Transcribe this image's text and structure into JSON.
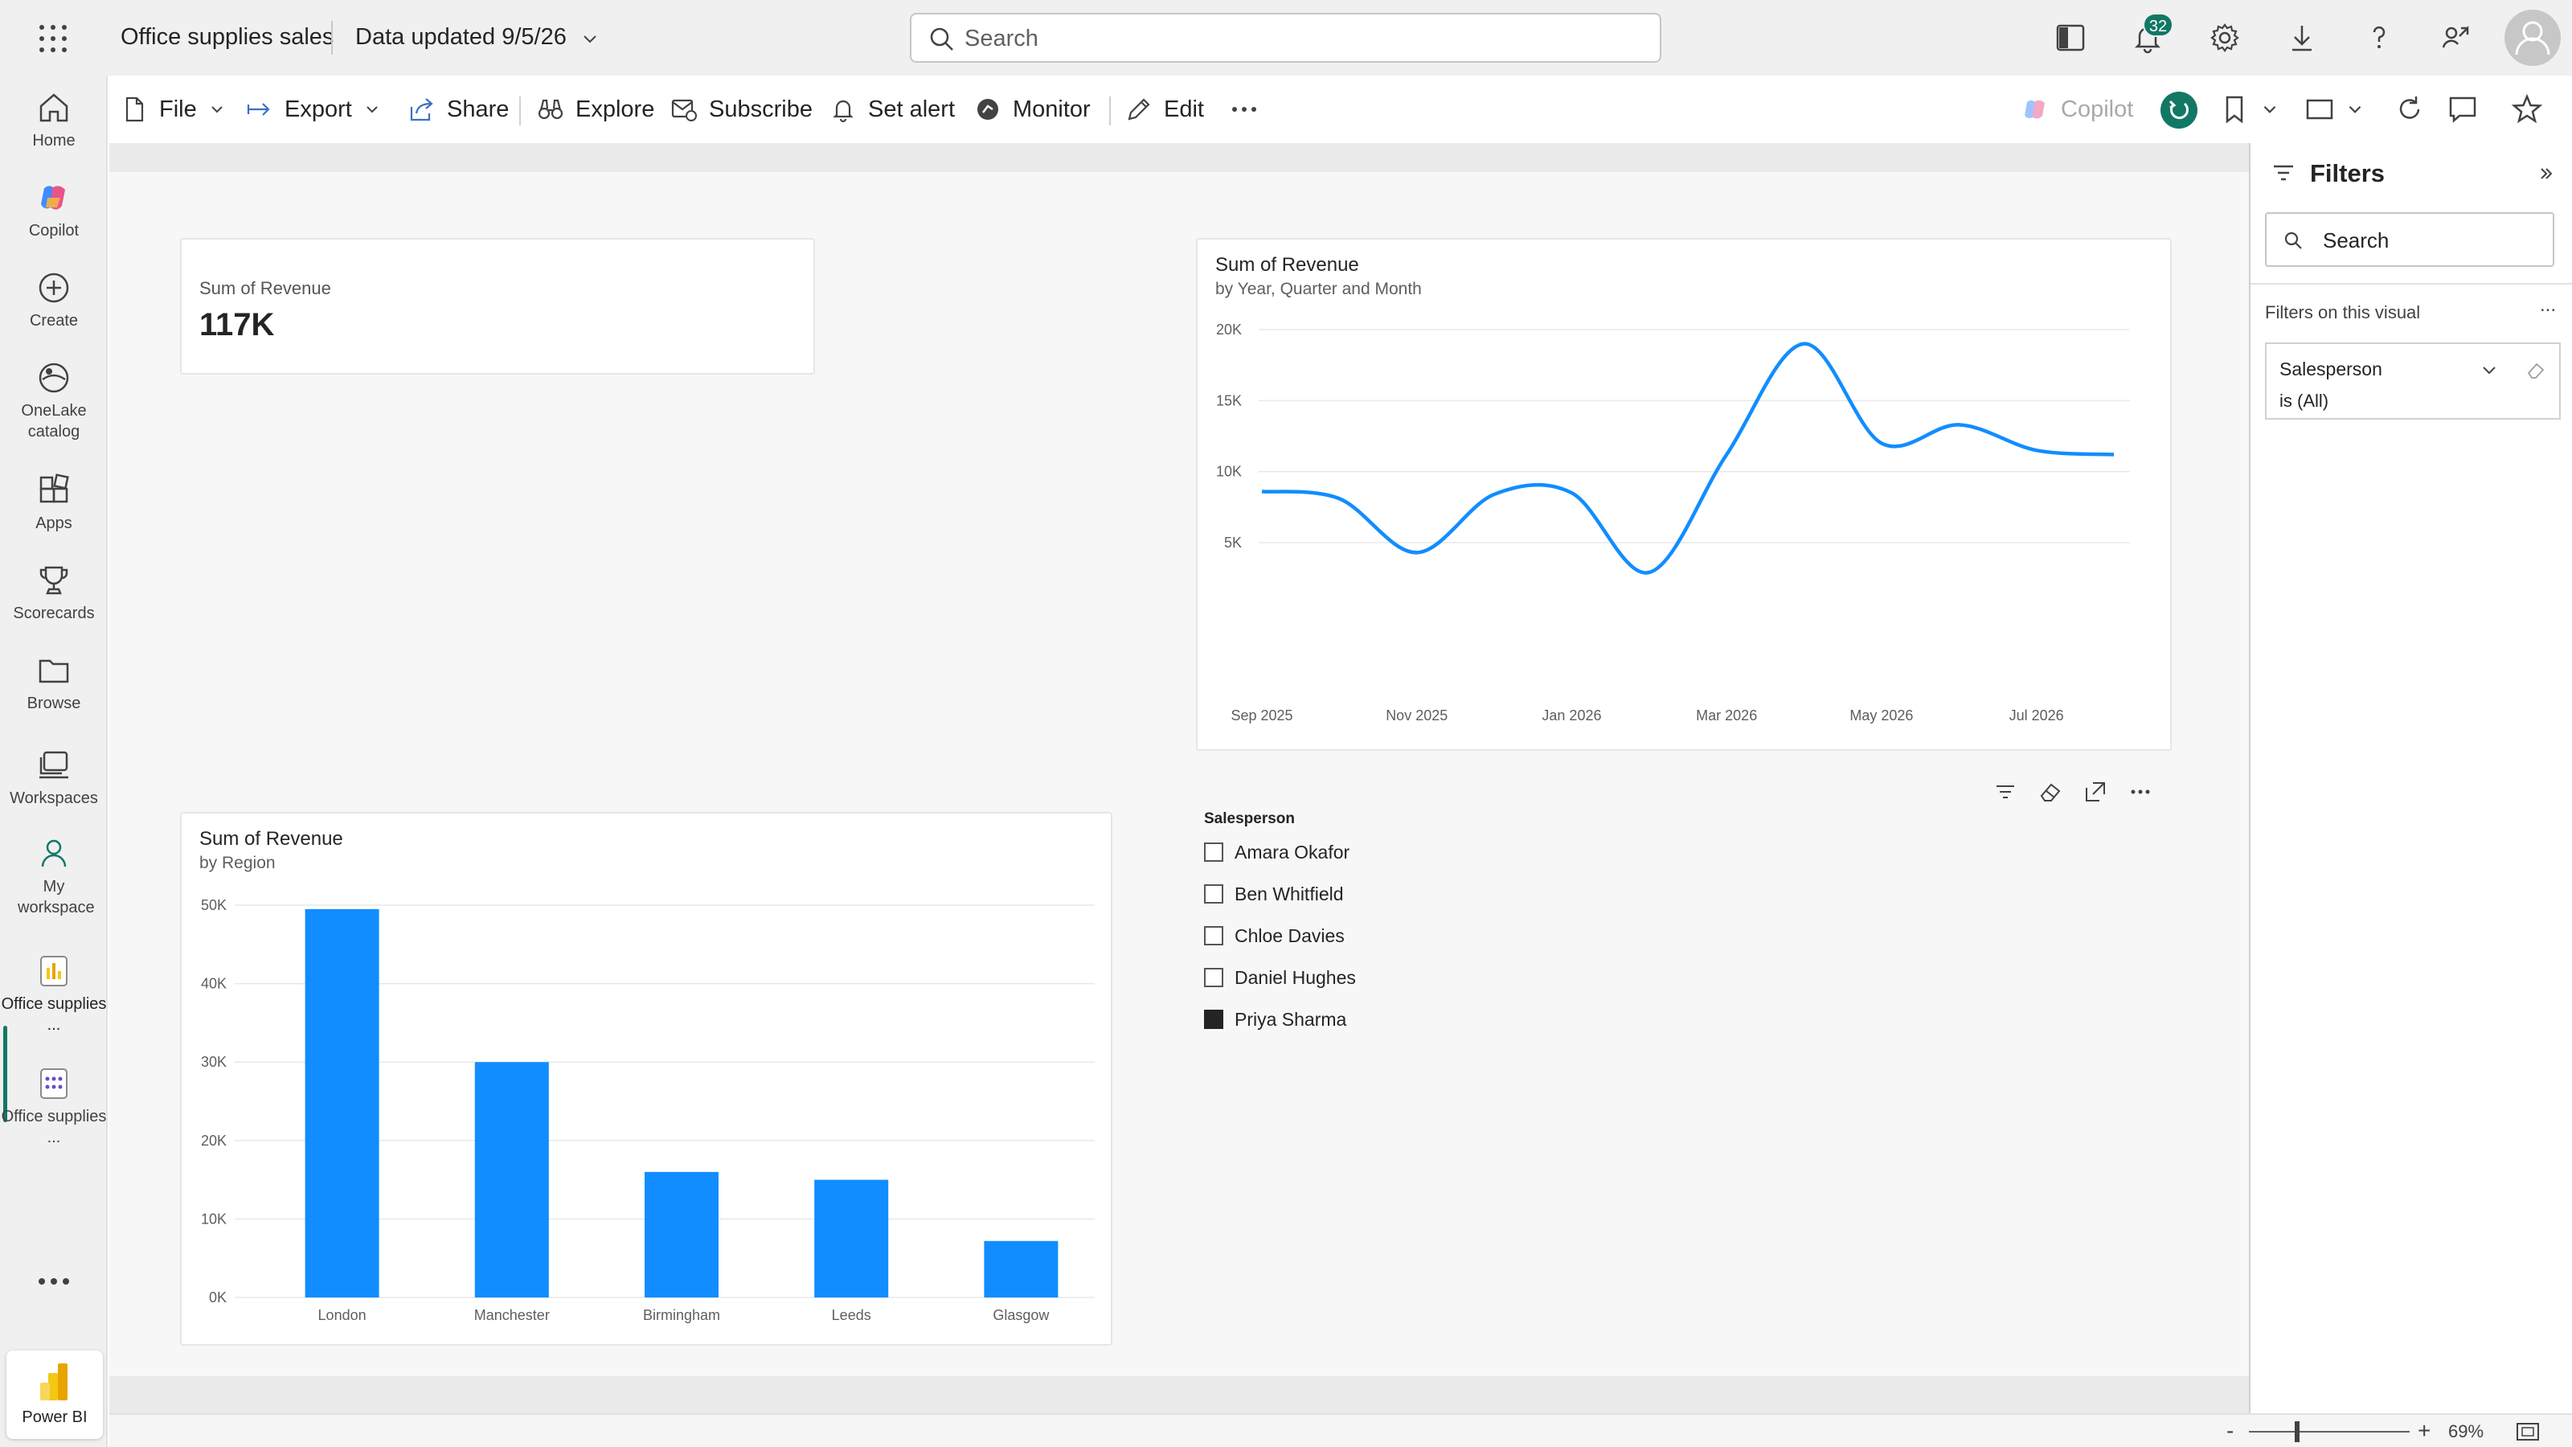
{
  "topbar": {
    "app_title": "Office supplies sales",
    "data_updated": "Data updated 9/5/26",
    "search_placeholder": "Search",
    "notification_count": "32"
  },
  "leftnav": {
    "items": [
      {
        "label": "Home",
        "icon": "home-icon"
      },
      {
        "label": "Copilot",
        "icon": "copilot-icon"
      },
      {
        "label": "Create",
        "icon": "create-icon"
      },
      {
        "label": "OneLake catalog",
        "icon": "onelake-icon"
      },
      {
        "label": "Apps",
        "icon": "apps-icon"
      },
      {
        "label": "Scorecards",
        "icon": "trophy-icon"
      },
      {
        "label": "Browse",
        "icon": "folder-icon"
      },
      {
        "label": "Workspaces",
        "icon": "workspaces-icon"
      },
      {
        "label": "My workspace",
        "icon": "person-icon"
      },
      {
        "label": "Office supplies ...",
        "icon": "report-icon"
      },
      {
        "label": "Office supplies ...",
        "icon": "semantic-model-icon"
      }
    ],
    "powerbi_label": "Power BI"
  },
  "commandbar": {
    "file": "File",
    "export": "Export",
    "share": "Share",
    "explore": "Explore",
    "subscribe": "Subscribe",
    "set_alert": "Set alert",
    "monitor": "Monitor",
    "edit": "Edit",
    "copilot": "Copilot"
  },
  "kpi": {
    "label": "Sum of Revenue",
    "value": "117K"
  },
  "line_chart": {
    "title": "Sum of Revenue",
    "subtitle": "by Year, Quarter and Month"
  },
  "bar_chart": {
    "title": "Sum of Revenue",
    "subtitle": "by Region"
  },
  "chart_data": [
    {
      "type": "line",
      "title": "Sum of Revenue",
      "subtitle": "by Year, Quarter and Month",
      "x": [
        "Sep 2025",
        "Oct 2025",
        "Nov 2025",
        "Dec 2025",
        "Jan 2026",
        "Feb 2026",
        "Mar 2026",
        "Apr 2026",
        "May 2026",
        "Jun 2026",
        "Jul 2026",
        "Aug 2026"
      ],
      "x_tick_labels": [
        "Sep 2025",
        "Nov 2025",
        "Jan 2026",
        "Mar 2026",
        "May 2026",
        "Jul 2026"
      ],
      "values": [
        8600,
        8100,
        4300,
        8400,
        8500,
        2900,
        11200,
        19000,
        12000,
        13300,
        11500,
        11200
      ],
      "ylim": [
        2000,
        20000
      ],
      "y_ticks": [
        "5K",
        "10K",
        "15K",
        "20K"
      ],
      "y_tick_values": [
        5000,
        10000,
        15000,
        20000
      ],
      "color": "#118DFF",
      "grid": true
    },
    {
      "type": "bar",
      "title": "Sum of Revenue",
      "subtitle": "by Region",
      "categories": [
        "London",
        "Manchester",
        "Birmingham",
        "Leeds",
        "Glasgow"
      ],
      "values": [
        49500,
        30000,
        16000,
        15000,
        7200
      ],
      "ylim": [
        0,
        50000
      ],
      "y_ticks": [
        "0K",
        "10K",
        "20K",
        "30K",
        "40K",
        "50K"
      ],
      "y_tick_values": [
        0,
        10000,
        20000,
        30000,
        40000,
        50000
      ],
      "color": "#118DFF",
      "grid": true
    }
  ],
  "slicer": {
    "title": "Salesperson",
    "items": [
      {
        "label": "Amara Okafor",
        "checked": false
      },
      {
        "label": "Ben Whitfield",
        "checked": false
      },
      {
        "label": "Chloe Davies",
        "checked": false
      },
      {
        "label": "Daniel Hughes",
        "checked": false
      },
      {
        "label": "Priya Sharma",
        "checked": true
      }
    ]
  },
  "filters": {
    "title": "Filters",
    "search_placeholder": "Search",
    "section_label": "Filters on this visual",
    "more": "...",
    "card_field": "Salesperson",
    "card_value": "is (All)"
  },
  "footer": {
    "zoom_minus": "-",
    "zoom_plus": "+",
    "zoom_level": "69%",
    "zoom_fraction": 0.3
  },
  "colors": {
    "accent": "#117865",
    "series": "#118DFF"
  }
}
